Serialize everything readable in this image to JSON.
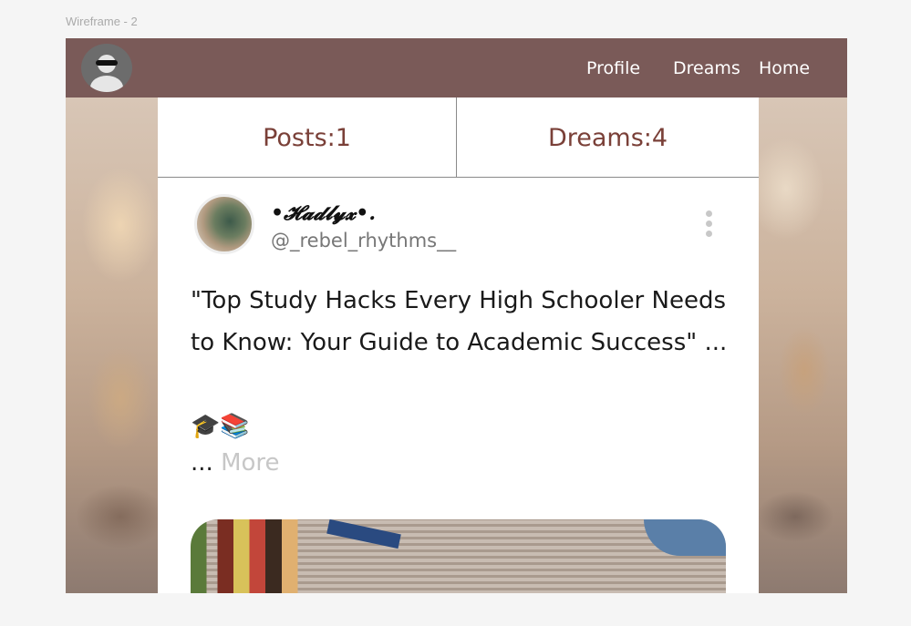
{
  "frame": {
    "label": "Wireframe - 2"
  },
  "navbar": {
    "avatar_icon": "user-avatar-with-sunglasses-icon",
    "links": [
      "Profile",
      "Dreams",
      "Home"
    ]
  },
  "stats": {
    "posts_label": "Posts:1",
    "dreams_label": "Dreams:4"
  },
  "post": {
    "display_name": "•𝓗𝓪𝓭𝓵𝔂𝔁•.",
    "handle": "@_rebel_rhythms__",
    "title": "\"Top Study Hacks Every High Schooler Needs to Know: Your Guide to Academic Success\" ...",
    "emoji": "🎓📚",
    "ellipsis": "...",
    "more_label": "More",
    "menu_icon": "more-vertical-icon"
  },
  "colors": {
    "navbar": "#7a5a58",
    "stat_text": "#7a4038",
    "more_link": "#c7c7c7"
  }
}
